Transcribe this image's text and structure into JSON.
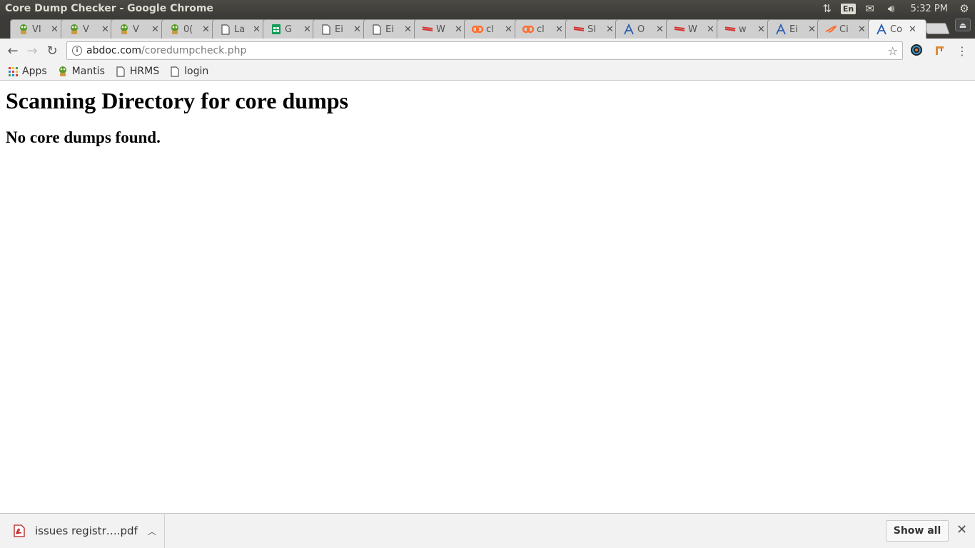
{
  "window": {
    "title": "Core Dump Checker - Google Chrome",
    "time": "5:32 PM",
    "lang": "En"
  },
  "tabs": [
    {
      "title": "VI",
      "icon": "mantis-icon"
    },
    {
      "title": "V",
      "icon": "mantis-icon"
    },
    {
      "title": "V",
      "icon": "mantis-icon"
    },
    {
      "title": "0(",
      "icon": "mantis-icon"
    },
    {
      "title": "La",
      "icon": "page-icon"
    },
    {
      "title": "G",
      "icon": "sheets-icon"
    },
    {
      "title": "Ei",
      "icon": "page-icon"
    },
    {
      "title": "Ei",
      "icon": "page-icon"
    },
    {
      "title": "W",
      "icon": "red-stripes-icon"
    },
    {
      "title": "cl",
      "icon": "cpanel-icon"
    },
    {
      "title": "cl",
      "icon": "cpanel-icon"
    },
    {
      "title": "Sl",
      "icon": "red-stripes-icon"
    },
    {
      "title": "O",
      "icon": "a-logo-icon"
    },
    {
      "title": "W",
      "icon": "red-stripes-icon"
    },
    {
      "title": "w",
      "icon": "red-stripes-icon"
    },
    {
      "title": "Ei",
      "icon": "a-logo-icon"
    },
    {
      "title": "Ci",
      "icon": "bird-icon"
    },
    {
      "title": "Co",
      "icon": "a-logo-icon",
      "active": true
    }
  ],
  "toolbar": {
    "url_host": "abdoc.com",
    "url_path": "/coredumpcheck.php"
  },
  "bookmarks": [
    {
      "label": "Apps",
      "icon": "apps-grid-icon"
    },
    {
      "label": "Mantis",
      "icon": "mantis-icon"
    },
    {
      "label": "HRMS",
      "icon": "page-icon"
    },
    {
      "label": "login",
      "icon": "page-icon"
    }
  ],
  "page": {
    "heading": "Scanning Directory for core dumps",
    "message": "No core dumps found."
  },
  "download_shelf": {
    "file_name": "issues registr….pdf",
    "show_all_label": "Show all"
  }
}
